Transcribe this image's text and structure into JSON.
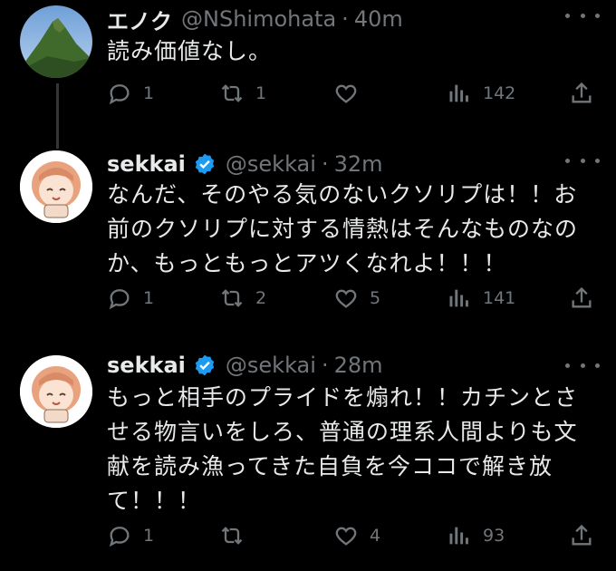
{
  "tweets": [
    {
      "name": "エノク",
      "handle": "@NShimohata",
      "time": "40m",
      "verified": false,
      "text": "読み価値なし。",
      "replies": "1",
      "retweets": "1",
      "likes": "",
      "views": "142"
    },
    {
      "name": "sekkai",
      "handle": "@sekkai",
      "time": "32m",
      "verified": true,
      "text": "なんだ、そのやる気のないクソリプは！！お\n前のクソリプに対する情熱はそんなものなの\nか、もっともっとアツくなれよ！！！",
      "replies": "1",
      "retweets": "2",
      "likes": "5",
      "views": "141"
    },
    {
      "name": "sekkai",
      "handle": "@sekkai",
      "time": "28m",
      "verified": true,
      "text": "もっと相手のプライドを煽れ！！カチンとさ\nせる物言いをしろ、普通の理系人間よりも文\n献を読み漁ってきた自負を今ココで解き放\nて！！！",
      "replies": "1",
      "retweets": "",
      "likes": "4",
      "views": "93"
    }
  ],
  "separator": "·",
  "colors": {
    "background": "#000000",
    "text": "#e7e9ea",
    "muted": "#71767b",
    "verified": "#1d9bf0",
    "thread_line": "#333639"
  },
  "icons": [
    "reply-icon",
    "retweet-icon",
    "like-icon",
    "views-icon",
    "share-icon",
    "more-icon",
    "verified-badge-icon"
  ]
}
